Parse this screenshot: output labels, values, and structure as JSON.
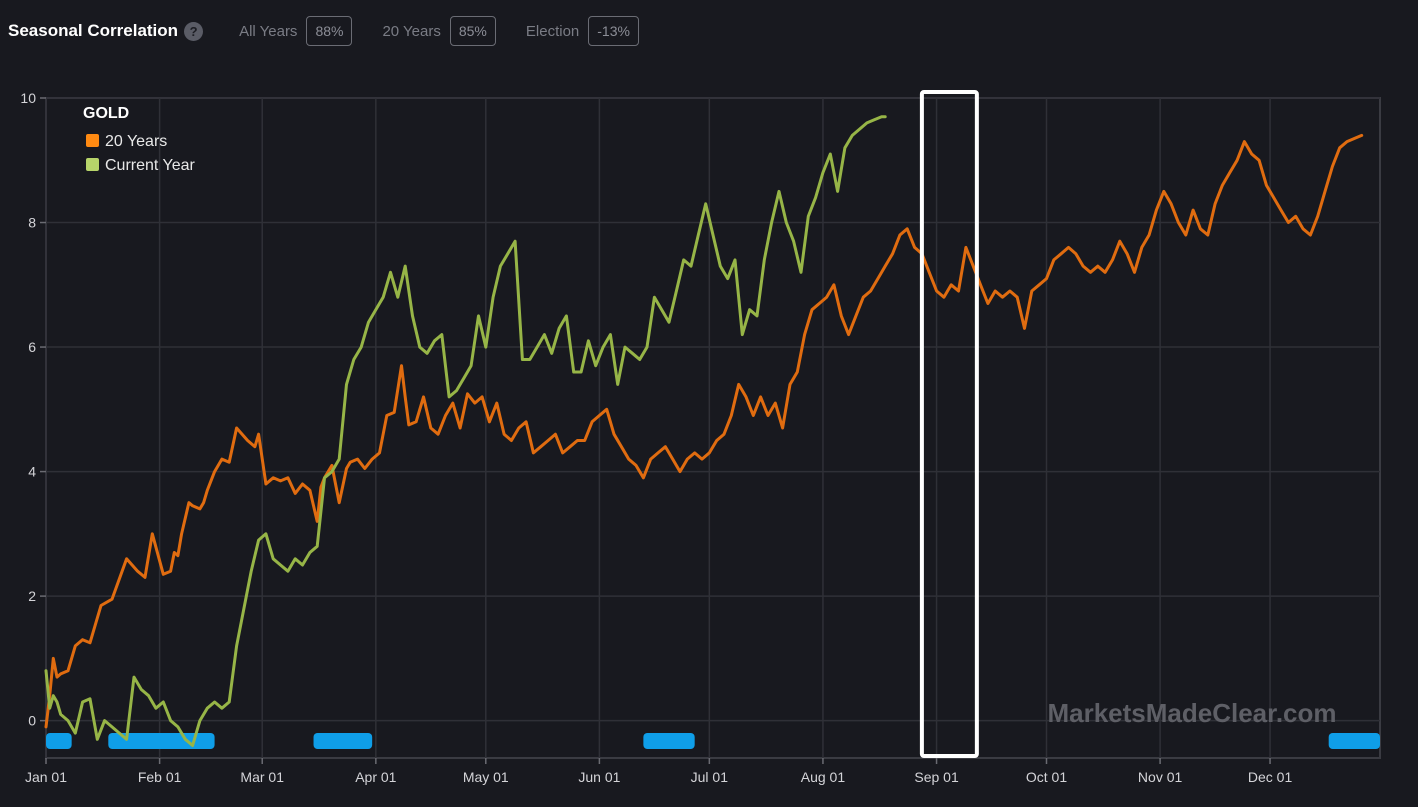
{
  "header": {
    "title": "Seasonal Correlation",
    "help": "?",
    "stats": [
      {
        "label": "All Years",
        "value": "88%"
      },
      {
        "label": "20 Years",
        "value": "85%"
      },
      {
        "label": "Election",
        "value": "-13%"
      }
    ]
  },
  "watermark": "MarketsMadeClear.com",
  "colors": {
    "background": "#18191f",
    "series_20y": "#e06c10",
    "series_current": "#97b547",
    "legend_20y": "#ff8a12",
    "legend_current": "#b7d46a",
    "marker": "#0f9ee8",
    "highlight": "#ffffff"
  },
  "chart_data": {
    "type": "line",
    "legend_title": "GOLD",
    "x_ticks": [
      "Jan 01",
      "Feb 01",
      "Mar 01",
      "Apr 01",
      "May 01",
      "Jun 01",
      "Jul 01",
      "Aug 01",
      "Sep 01",
      "Oct 01",
      "Nov 01",
      "Dec 01"
    ],
    "ylim": [
      -0.6,
      10
    ],
    "y_ticks": [
      0,
      2,
      4,
      6,
      8,
      10
    ],
    "grid": true,
    "legend_position": "top-left",
    "series": [
      {
        "name": "20 Years",
        "x_day": [
          1,
          2,
          3,
          4,
          5,
          7,
          9,
          11,
          13,
          16,
          19,
          23,
          26,
          28,
          30,
          33,
          35,
          36,
          37,
          38,
          40,
          41,
          43,
          44,
          45,
          47,
          49,
          51,
          53,
          56,
          58,
          59,
          61,
          63,
          65,
          67,
          69,
          71,
          73,
          75,
          76,
          77,
          79,
          81,
          83,
          84,
          86,
          88,
          90,
          92,
          94,
          96,
          98,
          99,
          100,
          102,
          104,
          106,
          108,
          110,
          112,
          114,
          116,
          118,
          120,
          122,
          124,
          126,
          128,
          130,
          132,
          134,
          136,
          138,
          140,
          142,
          144,
          146,
          148,
          150,
          152,
          154,
          156,
          158,
          160,
          162,
          164,
          166,
          168,
          170,
          172,
          174,
          176,
          178,
          180,
          182,
          184,
          186,
          188,
          190,
          192,
          194,
          196,
          198,
          200,
          202,
          204,
          206,
          208,
          210,
          212,
          214,
          216,
          218,
          220,
          222,
          224,
          226,
          228,
          230,
          232,
          234,
          236,
          238,
          240,
          242,
          244,
          246,
          248,
          250,
          252,
          254,
          256,
          258,
          260,
          262,
          264,
          266,
          268,
          270,
          272,
          274,
          276,
          278,
          280,
          282,
          284,
          286,
          288,
          290,
          292,
          294,
          296,
          298,
          300,
          302,
          304,
          306,
          308,
          310,
          312,
          314,
          316,
          318,
          320,
          322,
          324,
          326,
          328,
          330,
          332,
          334,
          336,
          338,
          340,
          342,
          344,
          346,
          348,
          350,
          352,
          354,
          356,
          358,
          360,
          362,
          364,
          365
        ],
        "y": [
          -0.1,
          0.4,
          1.0,
          0.7,
          0.75,
          0.8,
          1.2,
          1.3,
          1.25,
          1.85,
          1.95,
          2.6,
          2.4,
          2.3,
          3.0,
          2.35,
          2.4,
          2.7,
          2.65,
          3.0,
          3.5,
          3.45,
          3.4,
          3.5,
          3.7,
          4.0,
          4.2,
          4.15,
          4.7,
          4.5,
          4.4,
          4.6,
          3.8,
          3.9,
          3.85,
          3.9,
          3.65,
          3.8,
          3.7,
          3.2,
          3.75,
          3.9,
          4.1,
          3.5,
          4.05,
          4.15,
          4.2,
          4.05,
          4.2,
          4.3,
          4.9,
          4.95,
          5.7,
          5.2,
          4.75,
          4.8,
          5.2,
          4.7,
          4.6,
          4.9,
          5.1,
          4.7,
          5.25,
          5.1,
          5.2,
          4.8,
          5.1,
          4.6,
          4.5,
          4.7,
          4.8,
          4.3,
          4.4,
          4.5,
          4.6,
          4.3,
          4.4,
          4.5,
          4.5,
          4.8,
          4.9,
          5.0,
          4.6,
          4.4,
          4.2,
          4.1,
          3.9,
          4.2,
          4.3,
          4.4,
          4.2,
          4.0,
          4.2,
          4.3,
          4.2,
          4.3,
          4.5,
          4.6,
          4.9,
          5.4,
          5.2,
          4.9,
          5.2,
          4.9,
          5.1,
          4.7,
          5.4,
          5.6,
          6.2,
          6.6,
          6.7,
          6.8,
          7.0,
          6.5,
          6.2,
          6.5,
          6.8,
          6.9,
          7.1,
          7.3,
          7.5,
          7.8,
          7.9,
          7.6,
          7.5,
          7.2,
          6.9,
          6.8,
          7.0,
          6.9,
          7.6,
          7.3,
          7.0,
          6.7,
          6.9,
          6.8,
          6.9,
          6.8,
          6.3,
          6.9,
          7.0,
          7.1,
          7.4,
          7.5,
          7.6,
          7.5,
          7.3,
          7.2,
          7.3,
          7.2,
          7.4,
          7.7,
          7.5,
          7.2,
          7.6,
          7.8,
          8.2,
          8.5,
          8.3,
          8.0,
          7.8,
          8.2,
          7.9,
          7.8,
          8.3,
          8.6,
          8.8,
          9.0,
          9.3,
          9.1,
          9.0,
          8.6,
          8.4,
          8.2,
          8.0,
          8.1,
          7.9,
          7.8,
          8.1,
          8.5,
          8.9,
          9.2,
          9.3,
          9.35,
          9.4
        ]
      },
      {
        "name": "Current Year",
        "x_day": [
          1,
          2,
          3,
          4,
          5,
          7,
          9,
          11,
          13,
          15,
          17,
          19,
          21,
          23,
          25,
          27,
          29,
          31,
          33,
          35,
          37,
          39,
          41,
          43,
          45,
          47,
          49,
          51,
          53,
          55,
          57,
          59,
          61,
          63,
          65,
          67,
          69,
          71,
          73,
          75,
          77,
          79,
          81,
          83,
          85,
          87,
          89,
          91,
          93,
          95,
          97,
          99,
          101,
          103,
          105,
          107,
          109,
          111,
          113,
          115,
          117,
          119,
          121,
          123,
          125,
          127,
          129,
          131,
          133,
          135,
          137,
          139,
          141,
          143,
          145,
          147,
          149,
          151,
          153,
          155,
          157,
          159,
          161,
          163,
          165,
          167,
          169,
          171,
          173,
          175,
          177,
          179,
          181,
          183,
          185,
          187,
          189,
          191,
          193,
          195,
          197,
          199,
          201,
          203,
          205,
          207,
          209,
          211,
          213,
          215,
          217,
          219,
          221,
          223,
          225,
          227,
          229,
          230
        ],
        "y": [
          0.8,
          0.2,
          0.4,
          0.3,
          0.1,
          0.0,
          -0.2,
          0.3,
          0.35,
          -0.3,
          0.0,
          -0.1,
          -0.2,
          -0.3,
          0.7,
          0.5,
          0.4,
          0.2,
          0.3,
          0.0,
          -0.1,
          -0.3,
          -0.4,
          0.0,
          0.2,
          0.3,
          0.2,
          0.3,
          1.2,
          1.8,
          2.4,
          2.9,
          3.0,
          2.6,
          2.5,
          2.4,
          2.6,
          2.5,
          2.7,
          2.8,
          3.9,
          4.0,
          4.2,
          5.4,
          5.8,
          6.0,
          6.4,
          6.6,
          6.8,
          7.2,
          6.8,
          7.3,
          6.5,
          6.0,
          5.9,
          6.1,
          6.2,
          5.2,
          5.3,
          5.5,
          5.7,
          6.5,
          6.0,
          6.8,
          7.3,
          7.5,
          7.7,
          5.8,
          5.8,
          6.0,
          6.2,
          5.9,
          6.3,
          6.5,
          5.6,
          5.6,
          6.1,
          5.7,
          6.0,
          6.2,
          5.4,
          6.0,
          5.9,
          5.8,
          6.0,
          6.8,
          6.6,
          6.4,
          6.9,
          7.4,
          7.3,
          7.8,
          8.3,
          7.8,
          7.3,
          7.1,
          7.4,
          6.2,
          6.6,
          6.5,
          7.4,
          8.0,
          8.5,
          8.0,
          7.7,
          7.2,
          8.1,
          8.4,
          8.8,
          9.1,
          8.5,
          9.2,
          9.4,
          9.5,
          9.6,
          9.65,
          9.7,
          9.7
        ]
      }
    ]
  },
  "marker_ranges": [
    [
      1,
      8
    ],
    [
      18,
      47
    ],
    [
      74,
      90
    ],
    [
      164,
      178
    ],
    [
      351,
      365
    ]
  ],
  "highlight_range": [
    240,
    255
  ]
}
